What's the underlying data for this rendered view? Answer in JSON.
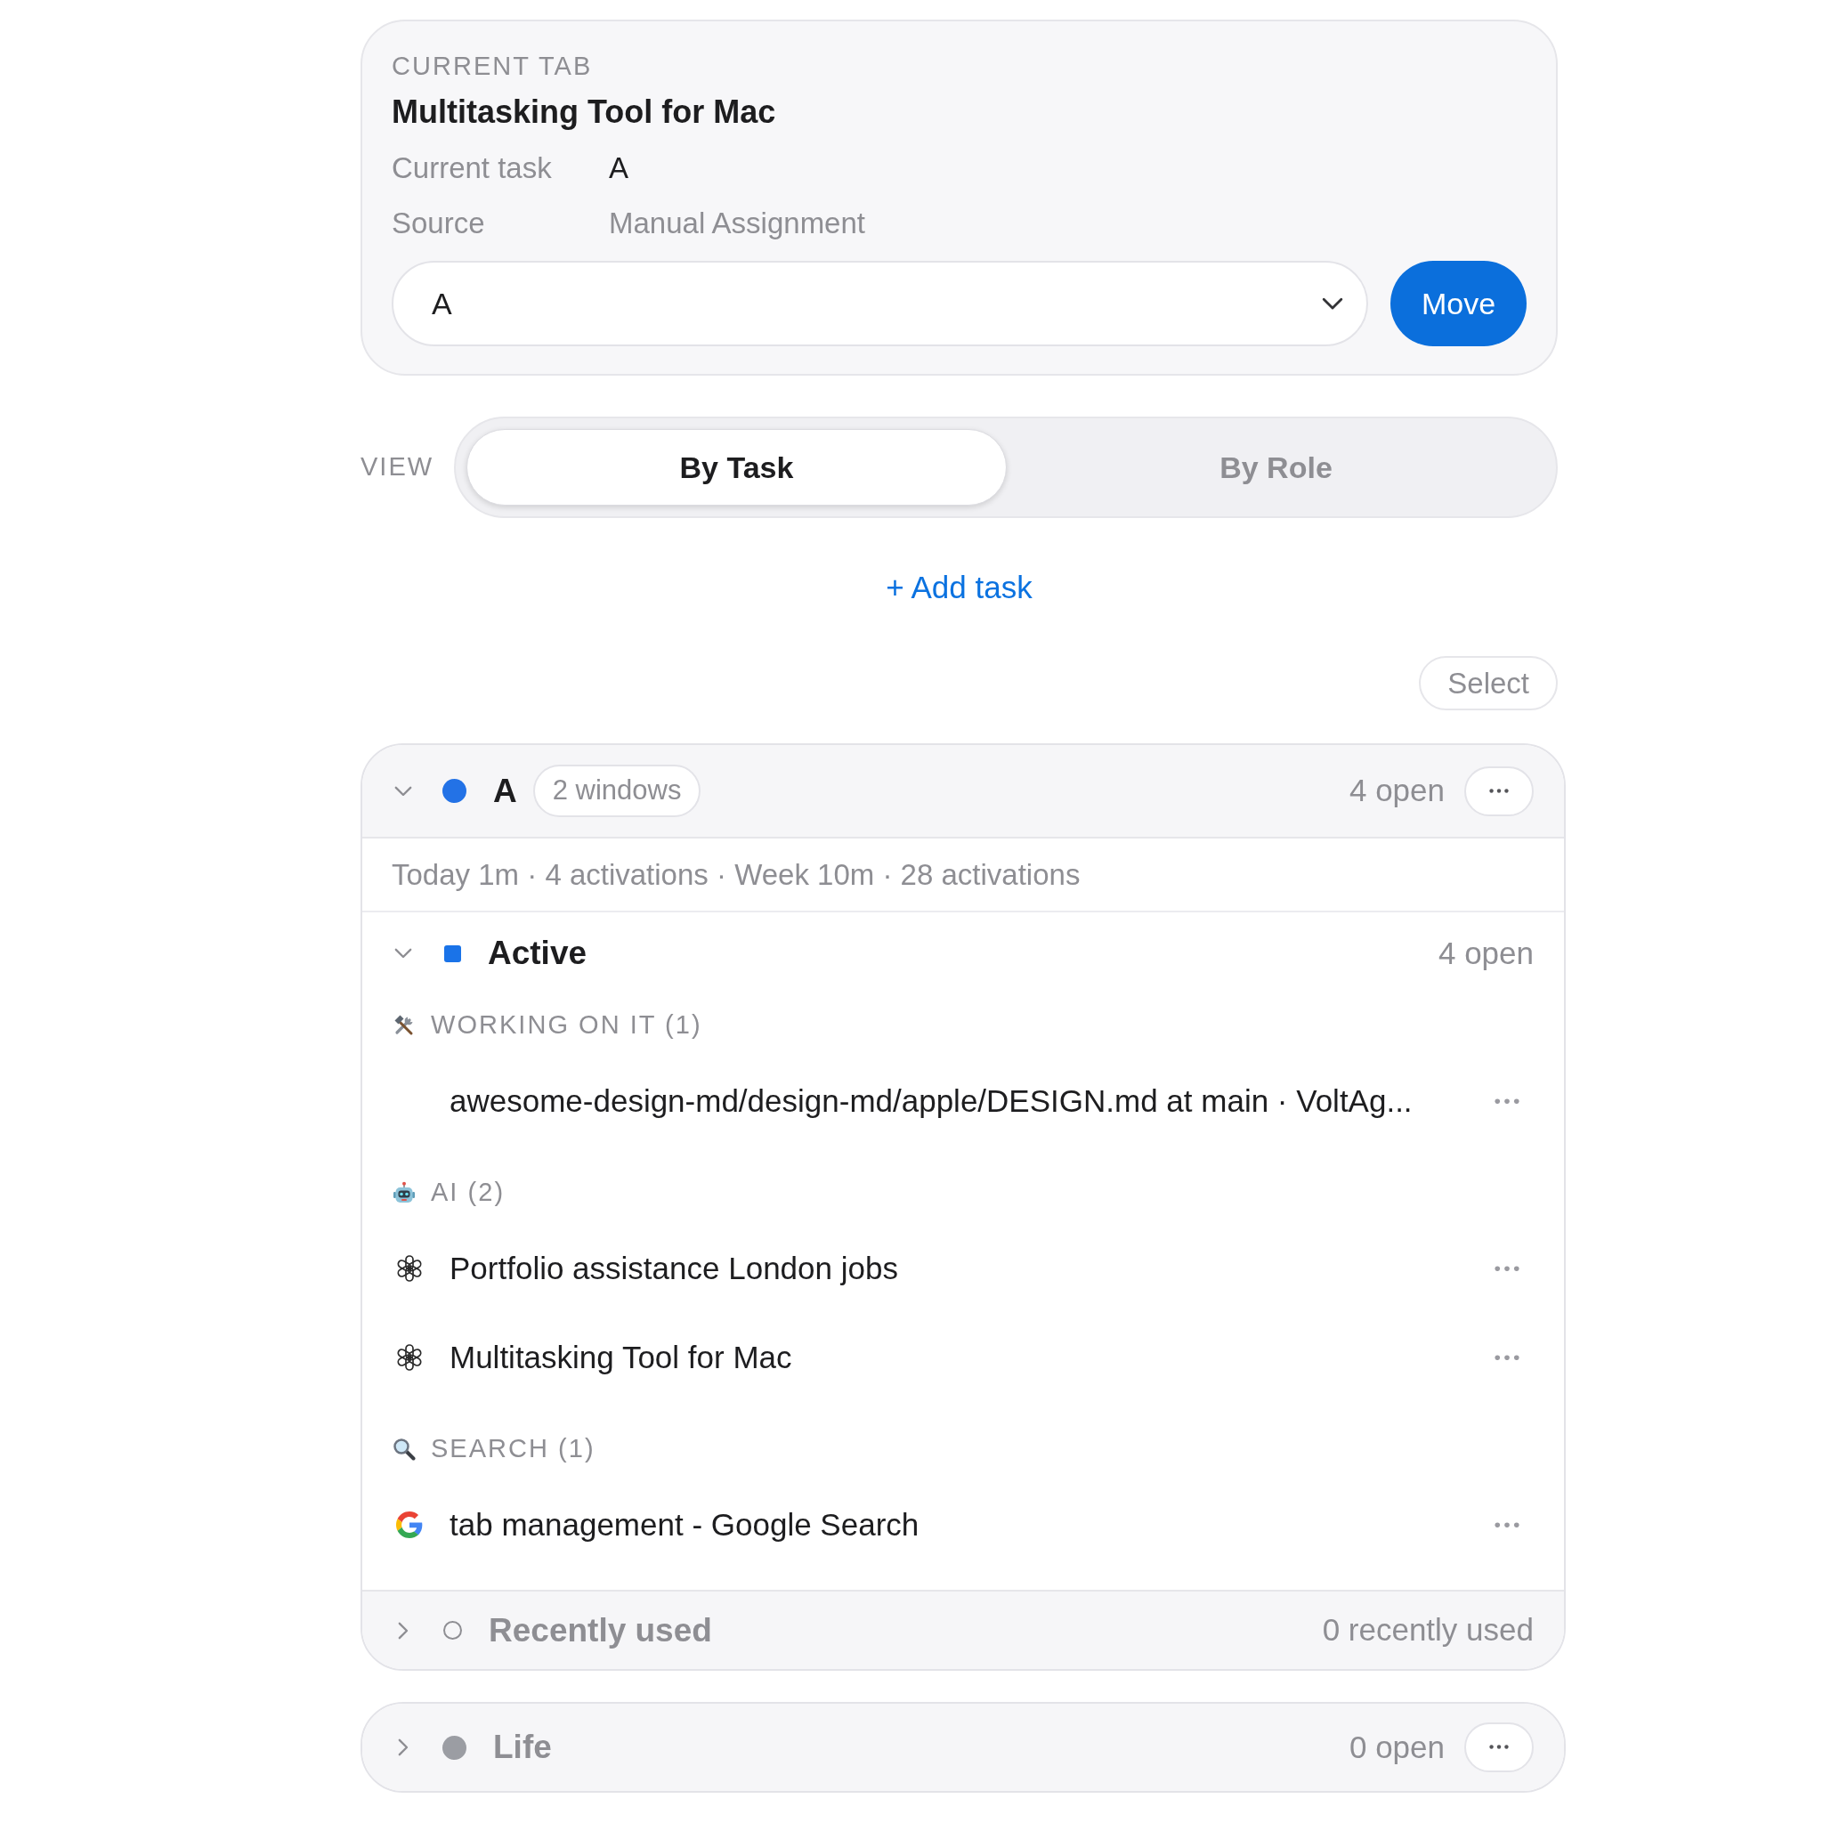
{
  "current_tab": {
    "heading": "CURRENT TAB",
    "title": "Multitasking Tool for Mac",
    "fields": [
      {
        "label": "Current task",
        "value": "A",
        "kind": "primary"
      },
      {
        "label": "Source",
        "value": "Manual Assignment",
        "kind": "secondary"
      }
    ],
    "task_select": {
      "value": "A"
    },
    "move_button": "Move"
  },
  "view": {
    "label": "VIEW",
    "tabs": [
      {
        "label": "By Task",
        "selected": true
      },
      {
        "label": "By Role",
        "selected": false
      }
    ]
  },
  "add_task": "+ Add task",
  "select_button": "Select",
  "tasks": [
    {
      "name": "A",
      "color": "#2372e6",
      "expanded": true,
      "windows": "2 windows",
      "open_count": "4 open",
      "stats": "Today 1m · 4 activations · Week 10m · 28 activations",
      "sections": [
        {
          "name": "Active",
          "kind": "active",
          "expanded": true,
          "count": "4 open",
          "groups": [
            {
              "label": "WORKING ON IT (1)",
              "kind": "working",
              "items": [
                {
                  "title": "awesome-design-md/design-md/apple/DESIGN.md at main · VoltAg...",
                  "kind": "plain"
                }
              ]
            },
            {
              "label": "AI (2)",
              "kind": "ai",
              "items": [
                {
                  "title": "Portfolio assistance London jobs",
                  "kind": "chat"
                },
                {
                  "title": "Multitasking Tool for Mac",
                  "kind": "chat"
                }
              ]
            },
            {
              "label": "SEARCH (1)",
              "kind": "search",
              "items": [
                {
                  "title": "tab management - Google Search",
                  "kind": "search"
                }
              ]
            }
          ]
        },
        {
          "name": "Recently used",
          "kind": "recent",
          "expanded": false,
          "count": "0 recently used"
        }
      ]
    },
    {
      "name": "Life",
      "color": "#9b9da3",
      "expanded": false,
      "open_count": "0 open"
    }
  ]
}
